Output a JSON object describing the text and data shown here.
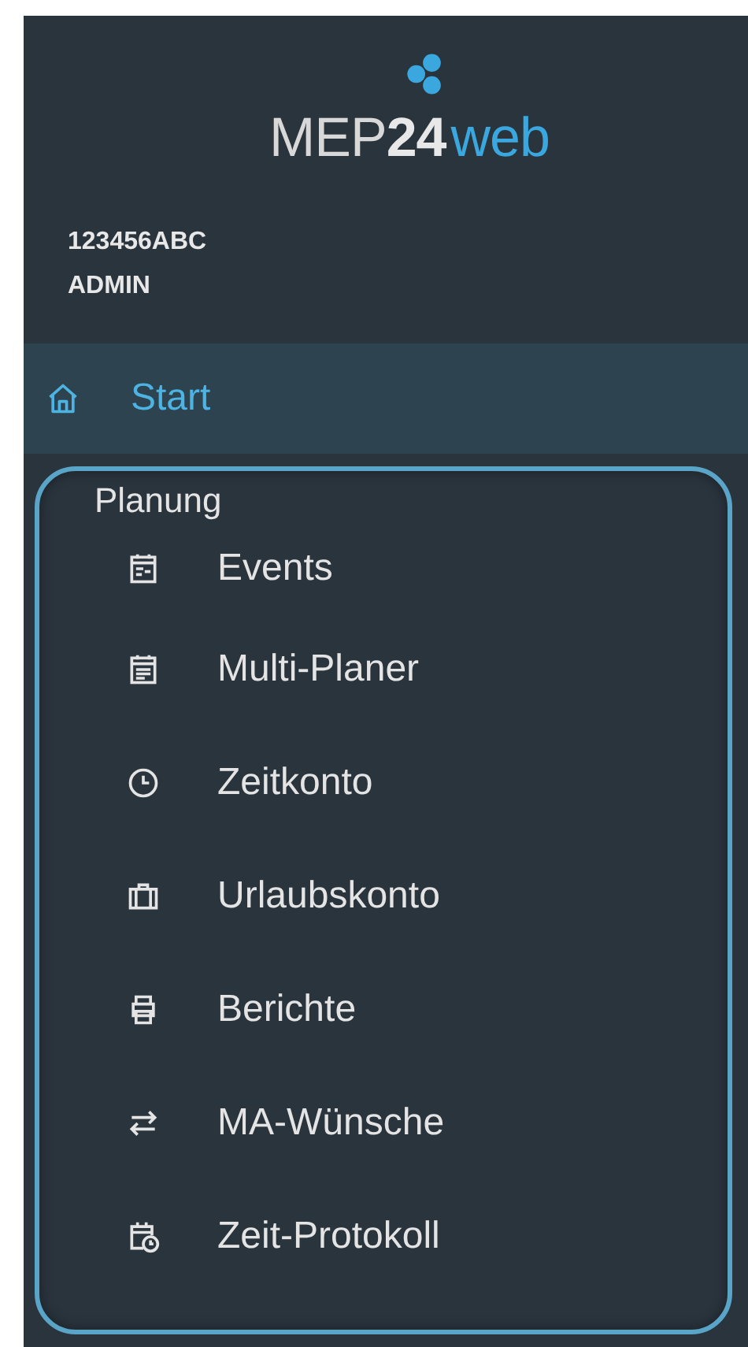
{
  "logo": {
    "name": "MEP",
    "number": "24",
    "suffix": "web"
  },
  "account": {
    "id": "123456ABC",
    "role": "ADMIN"
  },
  "start": {
    "label": "Start",
    "selected": true
  },
  "group": {
    "title": "Planung",
    "items": [
      {
        "label": "Events",
        "kind": "calendar-event"
      },
      {
        "label": "Multi-Planer",
        "kind": "calendar"
      },
      {
        "label": "Zeitkonto",
        "kind": "clock"
      },
      {
        "label": "Urlaubskonto",
        "kind": "suitcase"
      },
      {
        "label": "Berichte",
        "kind": "printer"
      },
      {
        "label": "MA-Wünsche",
        "kind": "swap"
      },
      {
        "label": "Zeit-Protokoll",
        "kind": "calendar-clock"
      }
    ]
  }
}
